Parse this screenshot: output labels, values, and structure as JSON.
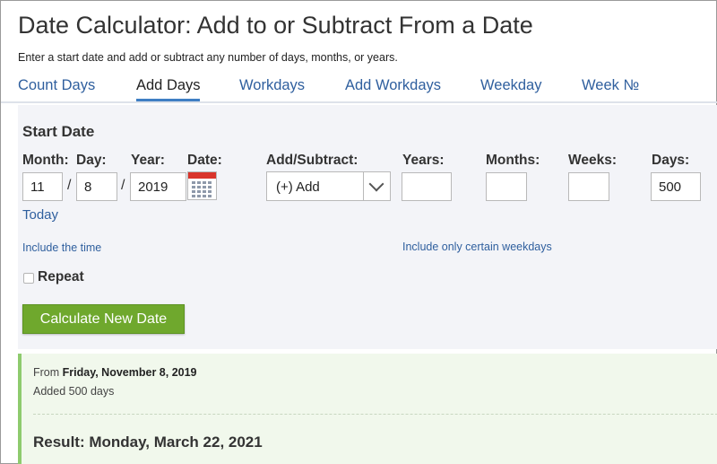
{
  "page": {
    "title": "Date Calculator: Add to or Subtract From a Date",
    "subtitle": "Enter a start date and add or subtract any number of days, months, or years."
  },
  "tabs": [
    {
      "label": "Count Days",
      "active": false
    },
    {
      "label": "Add Days",
      "active": true
    },
    {
      "label": "Workdays",
      "active": false
    },
    {
      "label": "Add Workdays",
      "active": false
    },
    {
      "label": "Weekday",
      "active": false
    },
    {
      "label": "Week №",
      "active": false
    }
  ],
  "form": {
    "section_title": "Start Date",
    "labels": {
      "month": "Month:",
      "day": "Day:",
      "year": "Year:",
      "date": "Date:",
      "add_subtract": "Add/Subtract:",
      "years": "Years:",
      "months": "Months:",
      "weeks": "Weeks:",
      "days": "Days:"
    },
    "separator": "/",
    "values": {
      "month": "11",
      "day": "8",
      "year": "2019",
      "operation": "(+) Add",
      "years": "",
      "months": "",
      "weeks": "",
      "days": "500"
    },
    "today_link": "Today",
    "include_time_link": "Include the time",
    "include_weekdays_link": "Include only certain weekdays",
    "repeat_label": "Repeat",
    "repeat_checked": false,
    "calculate_button": "Calculate New Date"
  },
  "result": {
    "from_prefix": "From",
    "from_date": "Friday, November 8, 2019",
    "added_text": "Added 500 days",
    "heading": "Result: Monday, March 22, 2021"
  },
  "colors": {
    "link": "#2f5f9e",
    "tab_active_underline": "#3f7fc4",
    "button_green": "#6fa82d",
    "result_background": "#f1f8ec",
    "result_border": "#8ecb6e",
    "form_background": "#f3f4f8"
  }
}
